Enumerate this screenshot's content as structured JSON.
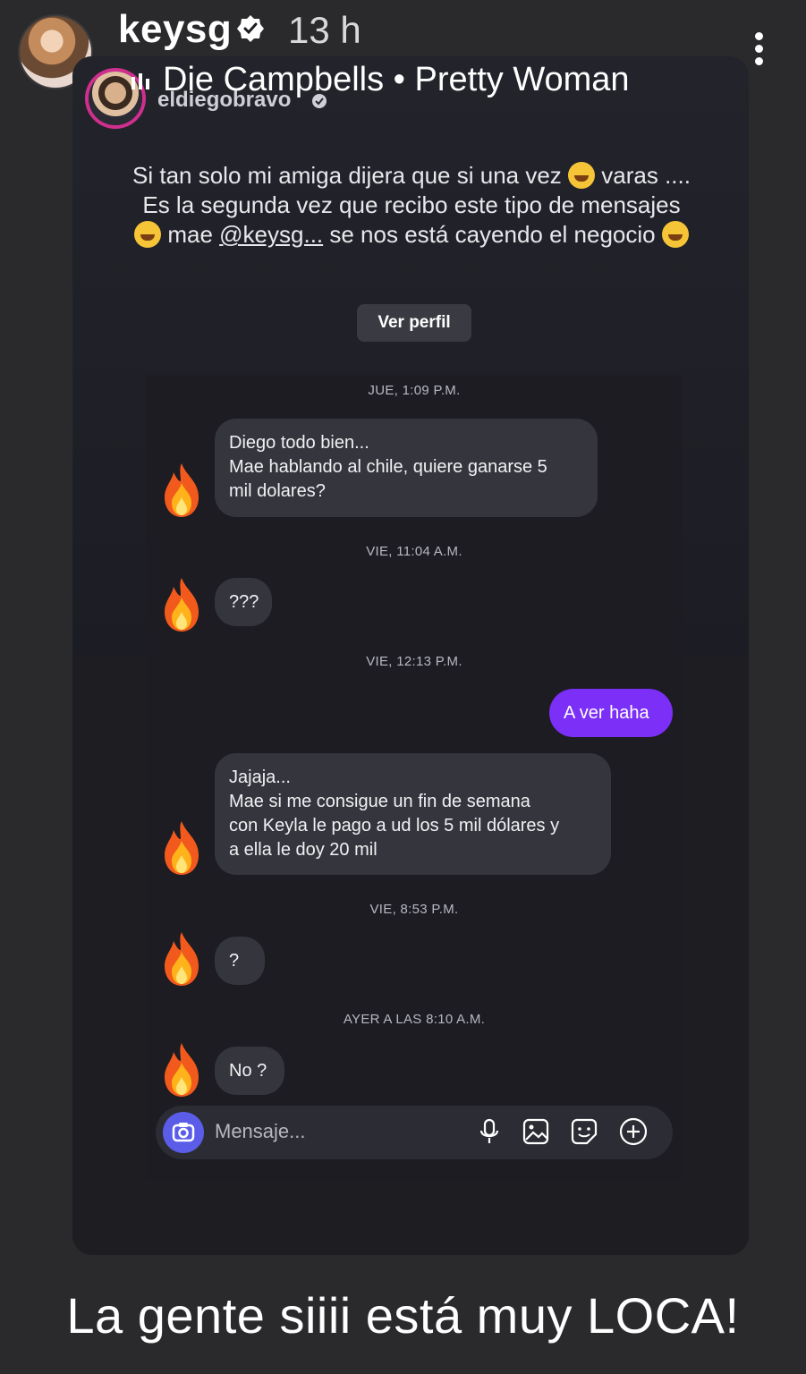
{
  "story": {
    "username": "keysg",
    "time": "13 h",
    "music_artist_song": "Die Campbells • Pretty Woman",
    "caption": "La gente siiii está muy LOCA!"
  },
  "post": {
    "dm_username": "eldiegobravo",
    "caption_line1": "Si tan solo mi amiga dijera que si una vez",
    "caption_line1b": "varas ....",
    "caption_line2": "Es la segunda vez que recibo este tipo de mensajes",
    "caption_line3a": "mae",
    "caption_mention": "@keysg...",
    "caption_line3b": "se nos está cayendo el negocio",
    "profile_button": "Ver perfil"
  },
  "chat": {
    "messages": [
      {
        "stamp": "JUE, 1:09 P.M.",
        "lines": [
          "Diego todo bien...",
          "Mae hablando al chile, quiere ganarse 5",
          "mil dolares?"
        ]
      },
      {
        "stamp": "VIE, 11:04 A.M.",
        "lines": [
          "???"
        ]
      },
      {
        "stamp": "VIE, 12:13 P.M.",
        "mine": "A ver haha"
      },
      {
        "lines": [
          "Jajaja...",
          "Mae si me consigue un fin de semana",
          "con Keyla le pago a ud los 5 mil dólares y",
          "a ella le doy 20 mil"
        ]
      },
      {
        "stamp": "VIE, 8:53 P.M.",
        "lines": [
          "?"
        ]
      },
      {
        "stamp": "AYER A LAS 8:10 A.M.",
        "lines": [
          "No ?"
        ]
      }
    ],
    "composer_placeholder": "Mensaje..."
  },
  "colors": {
    "accent": "#7b2ff7",
    "camera": "#5b5de8",
    "story_ring": "#d02f8f"
  }
}
